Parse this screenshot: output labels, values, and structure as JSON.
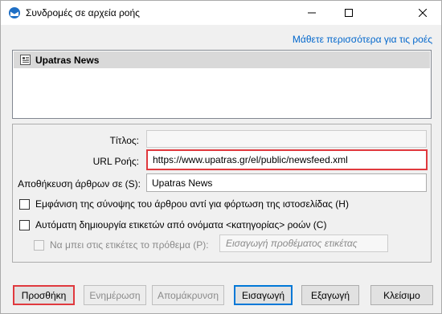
{
  "window": {
    "title": "Συνδρομές σε αρχεία ροής"
  },
  "learn_more": "Μάθετε περισσότερα για τις ροές",
  "feeds": [
    {
      "label": "Upatras News"
    }
  ],
  "form": {
    "title_label": "Τίτλος:",
    "title_value": "",
    "url_label": "URL Ροής:",
    "url_value": "https://www.upatras.gr/el/public/newsfeed.xml",
    "store_label": "Αποθήκευση άρθρων σε (S):",
    "store_value": "Upatras News",
    "summary_checkbox": "Εμφάνιση της σύνοψης του άρθρου αντί για φόρτωση της ιστοσελίδας (H)",
    "summary_checked": false,
    "tags_checkbox": "Αυτόματη δημιουργία ετικετών από ονόματα <κατηγορίας> ροών (C)",
    "tags_checked": false,
    "prefix_checkbox": "Να μπει στις ετικέτες το πρόθεμα (P):",
    "prefix_checked": false,
    "prefix_placeholder": "Εισαγωγή προθέματος ετικέτας"
  },
  "buttons": {
    "add": "Προσθήκη",
    "update": "Ενημέρωση",
    "remove": "Απομάκρυνση",
    "import": "Εισαγωγή",
    "export": "Εξαγωγή",
    "close": "Κλείσιμο"
  },
  "icons": {
    "app": "thunderbird-icon",
    "minimize": "minimize-icon",
    "maximize": "maximize-icon",
    "close": "close-icon",
    "feed": "newspaper-icon"
  }
}
